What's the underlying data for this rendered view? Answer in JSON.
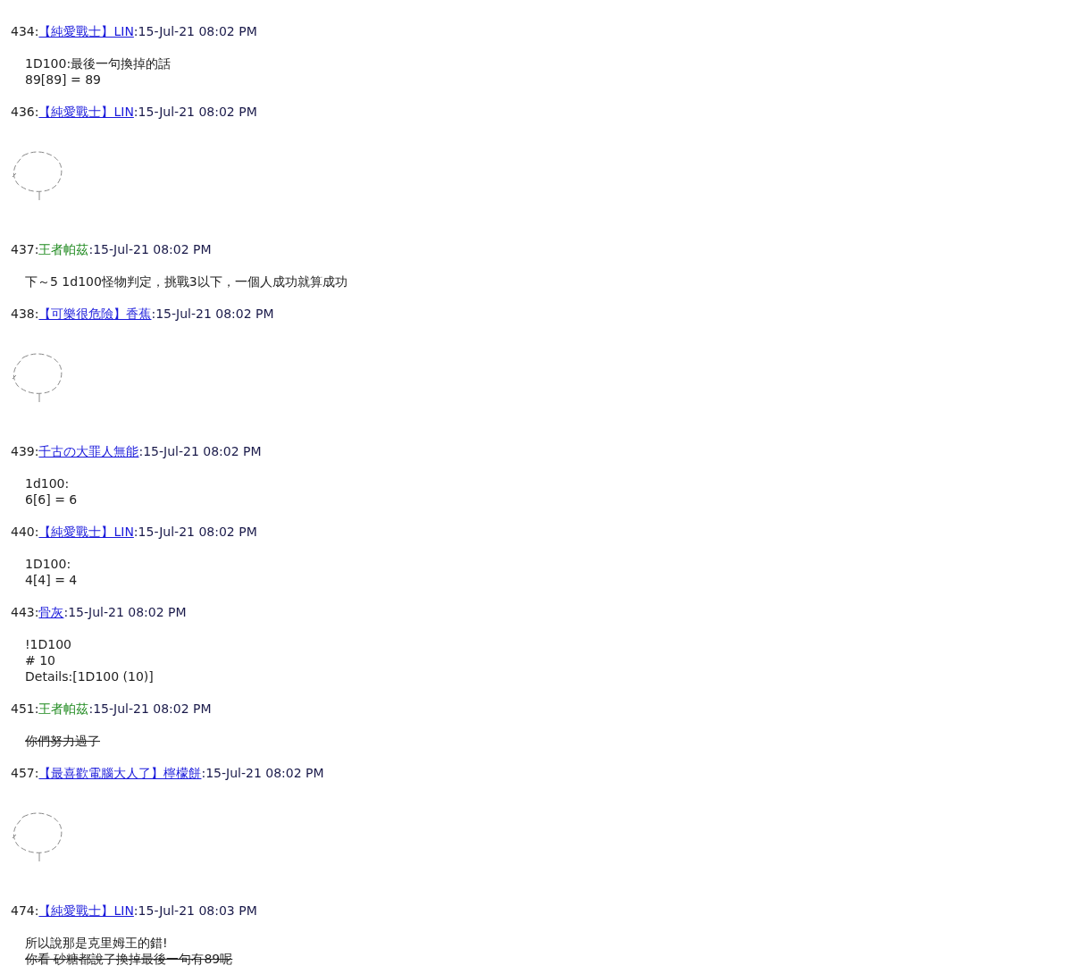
{
  "posts": [
    {
      "number": "434:",
      "author": {
        "name": "【純愛戰士】LIN",
        "linked": true
      },
      "date": ":15-Jul-21 08:02 PM",
      "body": {
        "kind": "text",
        "lines": [
          {
            "text": "1D100:最後一句換掉的話",
            "struck": false
          },
          {
            "text": "89[89] = 89",
            "struck": false
          }
        ]
      }
    },
    {
      "number": "436:",
      "author": {
        "name": "【純愛戰士】LIN",
        "linked": true
      },
      "date": ":15-Jul-21 08:02 PM",
      "body": {
        "kind": "art"
      }
    },
    {
      "number": "437:",
      "author": {
        "name": "王者帕茲",
        "linked": false
      },
      "date": ":15-Jul-21 08:02 PM",
      "body": {
        "kind": "text",
        "lines": [
          {
            "text": "下～5 1d100怪物判定，挑戰3以下，一個人成功就算成功",
            "struck": false
          }
        ]
      }
    },
    {
      "number": "438:",
      "author": {
        "name": "【可樂很危險】香蕉",
        "linked": true
      },
      "date": ":15-Jul-21 08:02 PM",
      "body": {
        "kind": "art"
      }
    },
    {
      "number": "439:",
      "author": {
        "name": "千古の大罪人無能",
        "linked": true
      },
      "date": ":15-Jul-21 08:02 PM",
      "body": {
        "kind": "text",
        "lines": [
          {
            "text": "1d100:",
            "struck": false
          },
          {
            "text": "6[6] = 6",
            "struck": false
          }
        ]
      }
    },
    {
      "number": "440:",
      "author": {
        "name": "【純愛戰士】LIN",
        "linked": true
      },
      "date": ":15-Jul-21 08:02 PM",
      "body": {
        "kind": "text",
        "lines": [
          {
            "text": "1D100:",
            "struck": false
          },
          {
            "text": "4[4] = 4",
            "struck": false
          }
        ]
      }
    },
    {
      "number": "443:",
      "author": {
        "name": "骨灰",
        "linked": true
      },
      "date": ":15-Jul-21 08:02 PM",
      "body": {
        "kind": "text",
        "lines": [
          {
            "text": "!1D100",
            "struck": false
          },
          {
            "text": "# 10",
            "struck": false
          },
          {
            "text": "Details:[1D100 (10)]",
            "struck": false
          }
        ]
      }
    },
    {
      "number": "451:",
      "author": {
        "name": "王者帕茲",
        "linked": false
      },
      "date": ":15-Jul-21 08:02 PM",
      "body": {
        "kind": "text",
        "lines": [
          {
            "text": "你們努力過了",
            "struck": true
          }
        ]
      }
    },
    {
      "number": "457:",
      "author": {
        "name": "【最喜歡電腦大人了】檸檬餅",
        "linked": true
      },
      "date": ":15-Jul-21 08:02 PM",
      "body": {
        "kind": "art"
      }
    },
    {
      "number": "474:",
      "author": {
        "name": "【純愛戰士】LIN",
        "linked": true
      },
      "date": ":15-Jul-21 08:03 PM",
      "body": {
        "kind": "text",
        "lines": [
          {
            "text": "所以說那是克里姆王的錯!",
            "struck": false
          },
          {
            "text": "你看 砂糖都說了換掉最後一句有89呢",
            "struck": true
          }
        ]
      }
    }
  ]
}
